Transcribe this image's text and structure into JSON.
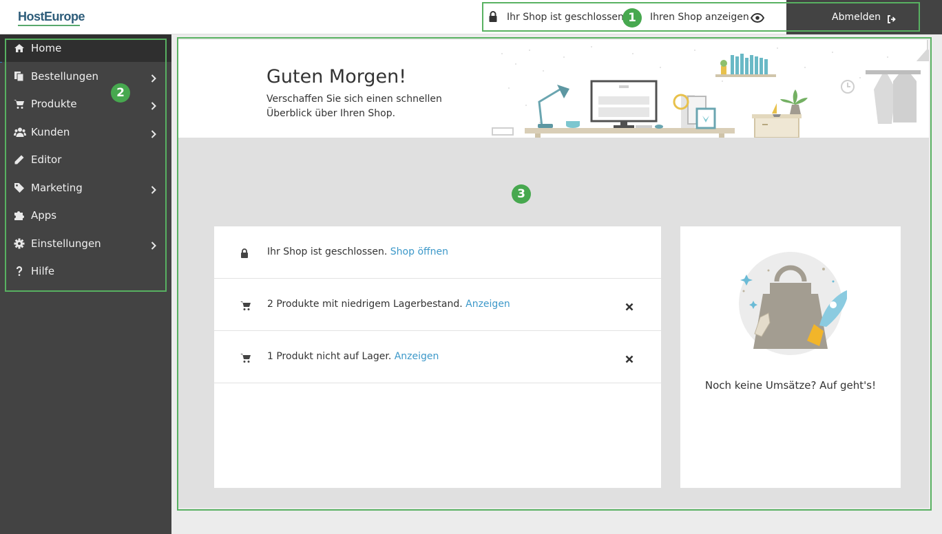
{
  "header": {
    "logo_text": "HostEurope",
    "status_text": "Ihr Shop ist geschlossen.",
    "view_shop_label": "Ihren Shop anzeigen",
    "logout_label": "Abmelden"
  },
  "sidebar": {
    "items": [
      {
        "label": "Home",
        "icon": "home-icon",
        "has_submenu": false,
        "active": true
      },
      {
        "label": "Bestellungen",
        "icon": "orders-icon",
        "has_submenu": true
      },
      {
        "label": "Produkte",
        "icon": "cart-icon",
        "has_submenu": true
      },
      {
        "label": "Kunden",
        "icon": "users-icon",
        "has_submenu": true
      },
      {
        "label": "Editor",
        "icon": "pencil-icon",
        "has_submenu": false
      },
      {
        "label": "Marketing",
        "icon": "tag-icon",
        "has_submenu": true
      },
      {
        "label": "Apps",
        "icon": "puzzle-icon",
        "has_submenu": false
      },
      {
        "label": "Einstellungen",
        "icon": "gear-icon",
        "has_submenu": true
      },
      {
        "label": "Hilfe",
        "icon": "question-icon",
        "has_submenu": false
      }
    ]
  },
  "hero": {
    "title": "Guten Morgen!",
    "subtitle": "Verschaffen Sie sich einen schnellen Überblick über Ihren Shop."
  },
  "notices": [
    {
      "icon": "lock-icon",
      "text": "Ihr Shop ist geschlossen.",
      "link": "Shop öffnen",
      "dismissible": false
    },
    {
      "icon": "cart-icon",
      "text": "2 Produkte mit niedrigem Lagerbestand.",
      "link": "Anzeigen",
      "dismissible": true
    },
    {
      "icon": "cart-icon",
      "text": "1 Produkt nicht auf Lager.",
      "link": "Anzeigen",
      "dismissible": true
    }
  ],
  "sales_card": {
    "message": "Noch keine Umsätze? Auf geht's!"
  },
  "callouts": {
    "one": "1",
    "two": "2",
    "three": "3"
  },
  "colors": {
    "accent_green": "#47a84f",
    "link_blue": "#3c98c9",
    "sidebar_bg": "#434343",
    "active_item_bg": "#2f2f2f"
  }
}
